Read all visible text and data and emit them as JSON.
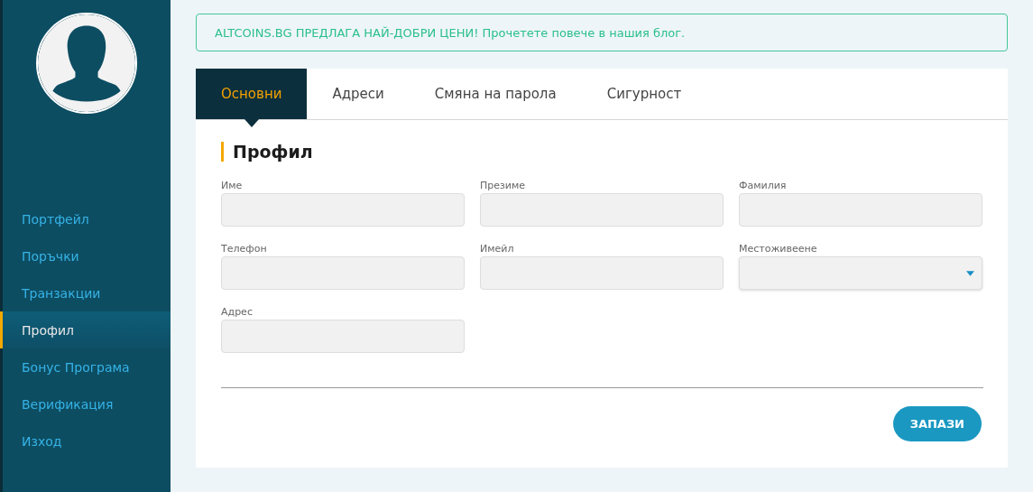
{
  "sidebar": {
    "items": [
      {
        "label": "Портфейл",
        "selected": false
      },
      {
        "label": "Поръчки",
        "selected": false
      },
      {
        "label": "Транзакции",
        "selected": false
      },
      {
        "label": "Профил",
        "selected": true
      },
      {
        "label": "Бонус Програма",
        "selected": false
      },
      {
        "label": "Верификация",
        "selected": false
      },
      {
        "label": "Изход",
        "selected": false
      }
    ]
  },
  "banner": "ALTCOINS.BG ПРЕДЛАГА НАЙ-ДОБРИ ЦЕНИ! Прочетете повече в нашия блог.",
  "tabs": [
    {
      "label": "Основни",
      "selected": true
    },
    {
      "label": "Адреси",
      "selected": false
    },
    {
      "label": "Смяна на парола",
      "selected": false
    },
    {
      "label": "Сигурност",
      "selected": false
    }
  ],
  "section_title": "Профил",
  "fields": [
    {
      "label": "Име",
      "kind": "input"
    },
    {
      "label": "Презиме",
      "kind": "input"
    },
    {
      "label": "Фамилия",
      "kind": "input"
    },
    {
      "label": "Телефон",
      "kind": "input"
    },
    {
      "label": "Имейл",
      "kind": "input"
    },
    {
      "label": "Местоживеене",
      "kind": "select"
    },
    {
      "label": "Адрес",
      "kind": "input"
    }
  ],
  "save_button": "ЗАПАЗИ"
}
